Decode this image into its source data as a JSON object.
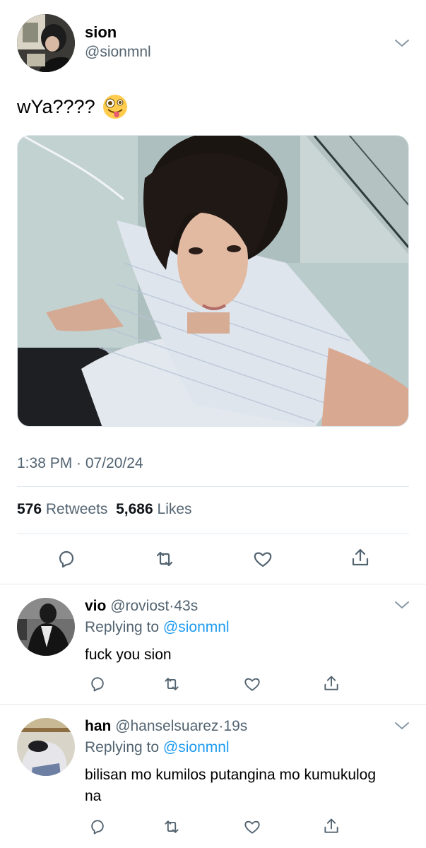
{
  "tweet": {
    "display_name": "sion",
    "handle": "@sionmnl",
    "text": "wYa????",
    "emoji_icon": "zany-face-icon",
    "timestamp": "1:38 PM · 07/20/24",
    "retweet_count": "576",
    "retweet_label": "Retweets",
    "like_count": "5,686",
    "like_label": "Likes",
    "actions": [
      "reply-icon",
      "retweet-icon",
      "like-icon",
      "share-icon"
    ]
  },
  "replies": [
    {
      "display_name": "vio",
      "handle": "@roviost",
      "separator": "·",
      "time": "43s",
      "replying_prefix": "Replying to",
      "replying_to": "@sionmnl",
      "text": "fuck you sion"
    },
    {
      "display_name": "han",
      "handle": "@hanselsuarez",
      "separator": "·",
      "time": "19s",
      "replying_prefix": "Replying to",
      "replying_to": "@sionmnl",
      "text": "bilisan mo kumilos putangina mo kumukulog na"
    }
  ],
  "colors": {
    "link": "#1d9bf0",
    "secondary_text": "#536471",
    "divider": "#e1e8ed"
  }
}
